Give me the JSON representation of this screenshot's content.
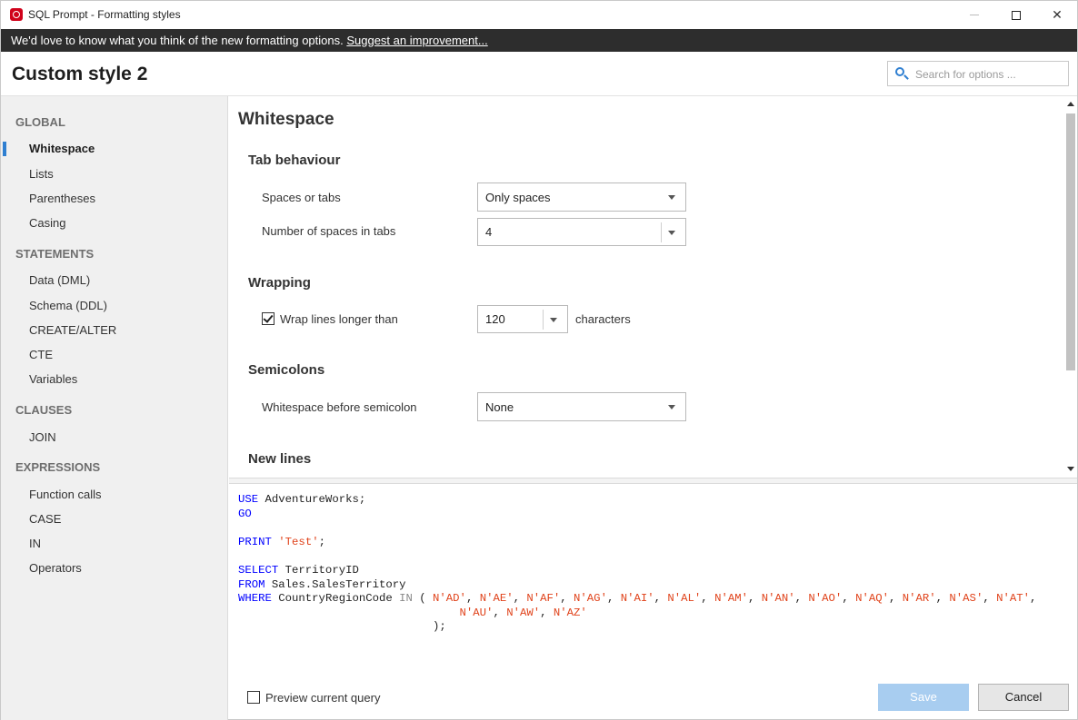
{
  "window": {
    "title": "SQL Prompt - Formatting styles",
    "close_glyph": "✕"
  },
  "feedback_bar": {
    "text": "We'd love to know what you think of the new formatting options. ",
    "link": "Suggest an improvement..."
  },
  "header": {
    "style_name": "Custom style 2",
    "search_placeholder": "Search for options ..."
  },
  "sidebar": {
    "groups": [
      {
        "label": "GLOBAL",
        "items": [
          "Whitespace",
          "Lists",
          "Parentheses",
          "Casing"
        ]
      },
      {
        "label": "STATEMENTS",
        "items": [
          "Data (DML)",
          "Schema (DDL)",
          "CREATE/ALTER",
          "CTE",
          "Variables"
        ]
      },
      {
        "label": "CLAUSES",
        "items": [
          "JOIN"
        ]
      },
      {
        "label": "EXPRESSIONS",
        "items": [
          "Function calls",
          "CASE",
          "IN",
          "Operators"
        ]
      }
    ],
    "active_item": "Whitespace"
  },
  "main": {
    "section_title": "Whitespace",
    "tab_behaviour": {
      "title": "Tab behaviour",
      "spaces_or_tabs_label": "Spaces or tabs",
      "spaces_or_tabs_value": "Only spaces",
      "num_spaces_label": "Number of spaces in tabs",
      "num_spaces_value": "4"
    },
    "wrapping": {
      "title": "Wrapping",
      "wrap_label": "Wrap lines longer than",
      "wrap_checked": true,
      "wrap_value": "120",
      "wrap_suffix": "characters"
    },
    "semicolons": {
      "title": "Semicolons",
      "label": "Whitespace before semicolon",
      "value": "None"
    },
    "new_lines": {
      "title": "New lines"
    }
  },
  "preview": {
    "line1_kw": "USE",
    "line1_rest": " AdventureWorks;",
    "line2_kw": "GO",
    "line3_kw": "PRINT",
    "line3_str": "'Test'",
    "line3_end": ";",
    "line4_kw": "SELECT",
    "line4_rest": " TerritoryID",
    "line5_kw": "FROM",
    "line5_rest": " Sales.SalesTerritory",
    "line6_kw": "WHERE",
    "line6_rest": " CountryRegionCode ",
    "line6_op": "IN",
    "line6_paren": " ( ",
    "in_values_1": [
      "N'AD'",
      "N'AE'",
      "N'AF'",
      "N'AG'",
      "N'AI'",
      "N'AL'",
      "N'AM'",
      "N'AN'",
      "N'AO'",
      "N'AQ'",
      "N'AR'",
      "N'AS'",
      "N'AT'"
    ],
    "in_values_2": [
      "N'AU'",
      "N'AW'",
      "N'AZ'"
    ],
    "close_paren": ");"
  },
  "footer": {
    "preview_label": "Preview current query",
    "preview_checked": false,
    "save_label": "Save",
    "cancel_label": "Cancel"
  },
  "colors": {
    "accent": "#2f7fd1",
    "keyword": "#0000ff",
    "string": "#e0431b",
    "feedback_bg": "#2d2d2d",
    "save_disabled": "#a8cdf0"
  }
}
